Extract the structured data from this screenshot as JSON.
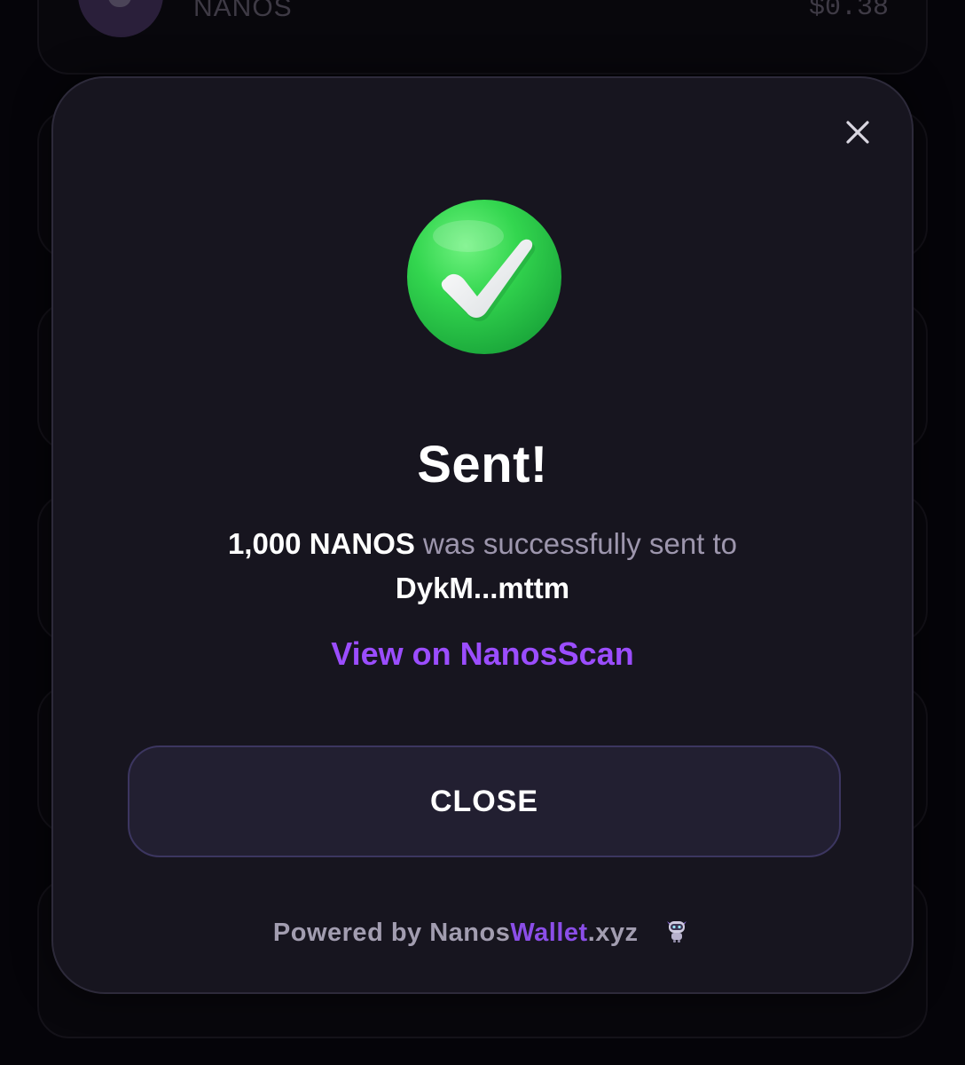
{
  "background": {
    "token_name": "NANOS",
    "token_value": "$0.38"
  },
  "modal": {
    "title": "Sent!",
    "message": {
      "amount": "1,000 NANOS",
      "middle": " was successfully sent to",
      "recipient": "DykM...mttm"
    },
    "link_label": "View on NanosScan",
    "close_button_label": "CLOSE",
    "footer": {
      "prefix": "Powered by Nanos",
      "accent": "Wallet",
      "suffix": ".xyz"
    }
  },
  "icons": {
    "dismiss": "close-icon",
    "status": "success-check-icon",
    "brand": "robot-mascot-icon"
  },
  "colors": {
    "modal_bg": "#17151f",
    "accent": "#9b4dff",
    "success": "#2fd54d",
    "muted_text": "#9d96ad"
  }
}
